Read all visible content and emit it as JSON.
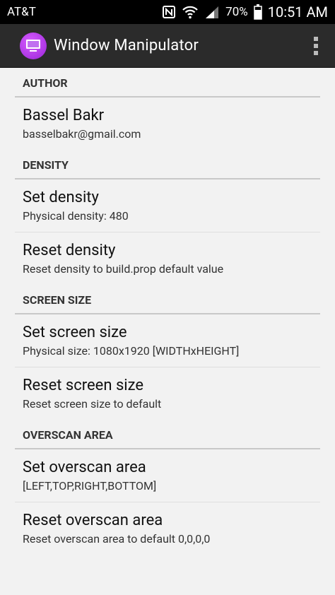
{
  "status_bar": {
    "carrier": "AT&T",
    "battery_percent": "70%",
    "time": "10:51 AM",
    "icons": [
      "nfc-icon",
      "wifi-icon",
      "signal-icon",
      "battery-icon"
    ]
  },
  "action_bar": {
    "app_title": "Window Manipulator",
    "app_icon": "monitor-icon",
    "menu_icon": "overflow-menu-icon"
  },
  "sections": {
    "author": {
      "header": "AUTHOR",
      "items": [
        {
          "title": "Bassel Bakr",
          "summary": "basselbakr@gmail.com"
        }
      ]
    },
    "density": {
      "header": "DENSITY",
      "items": [
        {
          "title": "Set density",
          "summary": "Physical density: 480"
        },
        {
          "title": "Reset density",
          "summary": "Reset density to build.prop default value"
        }
      ]
    },
    "screen_size": {
      "header": "SCREEN SIZE",
      "items": [
        {
          "title": "Set screen size",
          "summary": "Physical size: 1080x1920 [WIDTHxHEIGHT]"
        },
        {
          "title": "Reset screen size",
          "summary": "Reset screen size to default"
        }
      ]
    },
    "overscan": {
      "header": "OVERSCAN AREA",
      "items": [
        {
          "title": "Set overscan area",
          "summary": "[LEFT,TOP,RIGHT,BOTTOM]"
        },
        {
          "title": "Reset overscan area",
          "summary": "Reset overscan area to default 0,0,0,0"
        }
      ]
    }
  }
}
